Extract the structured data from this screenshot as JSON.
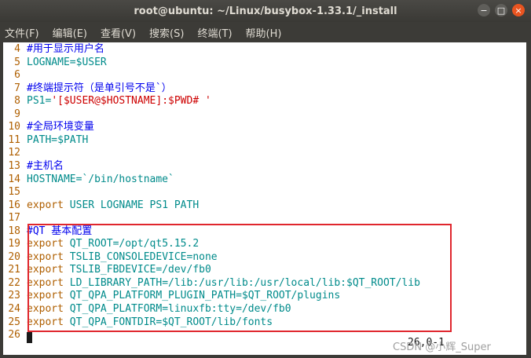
{
  "window": {
    "title": "root@ubuntu: ~/Linux/busybox-1.33.1/_install",
    "buttons": {
      "minimize": "−",
      "maximize": "□",
      "close": "×"
    }
  },
  "menu": [
    "文件(F)",
    "编辑(E)",
    "查看(V)",
    "搜索(S)",
    "终端(T)",
    "帮助(H)"
  ],
  "lines": [
    {
      "num": "4",
      "parts": [
        {
          "cls": "c-comment",
          "text": "#用于显示用户名"
        }
      ]
    },
    {
      "num": "5",
      "parts": [
        {
          "cls": "c-var",
          "text": "LOGNAME=$USER"
        }
      ]
    },
    {
      "num": "6",
      "parts": []
    },
    {
      "num": "7",
      "parts": [
        {
          "cls": "c-comment",
          "text": "#终端提示符（是单引号不是`）"
        }
      ]
    },
    {
      "num": "8",
      "parts": [
        {
          "cls": "c-var",
          "text": "PS1="
        },
        {
          "cls": "c-str",
          "text": "'[$USER@$HOSTNAME]:$PWD# '"
        }
      ]
    },
    {
      "num": "9",
      "parts": []
    },
    {
      "num": "10",
      "parts": [
        {
          "cls": "c-comment",
          "text": "#全局环境变量"
        }
      ]
    },
    {
      "num": "11",
      "parts": [
        {
          "cls": "c-var",
          "text": "PATH=$PATH"
        }
      ]
    },
    {
      "num": "12",
      "parts": []
    },
    {
      "num": "13",
      "parts": [
        {
          "cls": "c-comment",
          "text": "#主机名"
        }
      ]
    },
    {
      "num": "14",
      "parts": [
        {
          "cls": "c-var",
          "text": "HOSTNAME=`/bin/hostname`"
        }
      ]
    },
    {
      "num": "15",
      "parts": []
    },
    {
      "num": "16",
      "parts": [
        {
          "cls": "c-kw",
          "text": "export"
        },
        {
          "cls": "c-plain",
          "text": " USER LOGNAME PS1 PATH"
        }
      ]
    },
    {
      "num": "17",
      "parts": []
    },
    {
      "num": "18",
      "parts": [
        {
          "cls": "c-comment",
          "text": "#QT 基本配置"
        }
      ]
    },
    {
      "num": "19",
      "parts": [
        {
          "cls": "c-kw",
          "text": "export"
        },
        {
          "cls": "c-plain",
          "text": " QT_ROOT=/opt/qt5.15.2"
        }
      ]
    },
    {
      "num": "20",
      "parts": [
        {
          "cls": "c-kw",
          "text": "export"
        },
        {
          "cls": "c-plain",
          "text": " TSLIB_CONSOLEDEVICE=none"
        }
      ]
    },
    {
      "num": "21",
      "parts": [
        {
          "cls": "c-kw",
          "text": "export"
        },
        {
          "cls": "c-plain",
          "text": " TSLIB_FBDEVICE=/dev/fb0"
        }
      ]
    },
    {
      "num": "22",
      "parts": [
        {
          "cls": "c-kw",
          "text": "export"
        },
        {
          "cls": "c-plain",
          "text": " LD_LIBRARY_PATH=/lib:/usr/lib:/usr/local/lib:$QT_ROOT/lib"
        }
      ]
    },
    {
      "num": "23",
      "parts": [
        {
          "cls": "c-kw",
          "text": "export"
        },
        {
          "cls": "c-plain",
          "text": " QT_QPA_PLATFORM_PLUGIN_PATH=$QT_ROOT/plugins"
        }
      ]
    },
    {
      "num": "24",
      "parts": [
        {
          "cls": "c-kw",
          "text": "export"
        },
        {
          "cls": "c-plain",
          "text": " QT_QPA_PLATFORM=linuxfb:tty=/dev/fb0"
        }
      ]
    },
    {
      "num": "25",
      "parts": [
        {
          "cls": "c-kw",
          "text": "export"
        },
        {
          "cls": "c-plain",
          "text": " QT_QPA_FONTDIR=$QT_ROOT/lib/fonts"
        }
      ]
    },
    {
      "num": "26",
      "parts": []
    }
  ],
  "status_position": "26,0-1",
  "watermark": "CSDN @小辉_Super",
  "colors": {
    "line_number": "#af5f00",
    "comment": "#0000ee",
    "variable": "#008b8b",
    "keyword": "#af5f00",
    "string": "#cd0000",
    "highlight_border": "#e0262d",
    "close_button": "#e95420"
  }
}
